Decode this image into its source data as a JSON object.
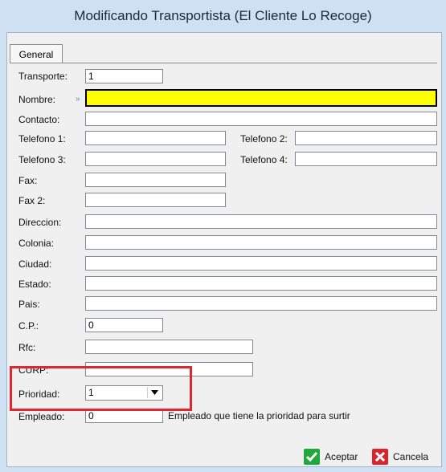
{
  "window": {
    "title": "Modificando Transportista  (El Cliente Lo Recoge)"
  },
  "tabs": {
    "general": "General"
  },
  "fields": {
    "transporte": {
      "label": "Transporte:",
      "value": "1"
    },
    "nombre": {
      "label": "Nombre:",
      "value": "",
      "marker": "»"
    },
    "contacto": {
      "label": "Contacto:",
      "value": ""
    },
    "telefono1": {
      "label": "Telefono 1:",
      "value": ""
    },
    "telefono2": {
      "label": "Telefono 2:",
      "value": ""
    },
    "telefono3": {
      "label": "Telefono 3:",
      "value": ""
    },
    "telefono4": {
      "label": "Telefono 4:",
      "value": ""
    },
    "fax": {
      "label": "Fax:",
      "value": ""
    },
    "fax2": {
      "label": "Fax 2:",
      "value": ""
    },
    "direccion": {
      "label": "Direccion:",
      "value": ""
    },
    "colonia": {
      "label": "Colonia:",
      "value": ""
    },
    "ciudad": {
      "label": "Ciudad:",
      "value": ""
    },
    "estado": {
      "label": "Estado:",
      "value": ""
    },
    "pais": {
      "label": "Pais:",
      "value": ""
    },
    "cp": {
      "label": "C.P.:",
      "value": "0"
    },
    "rfc": {
      "label": "Rfc:",
      "value": ""
    },
    "curp": {
      "label": "CURP:",
      "value": ""
    },
    "prioridad": {
      "label": "Prioridad:",
      "value": "1"
    },
    "empleado": {
      "label": "Empleado:",
      "value": "0",
      "hint": "Empleado que tiene la prioridad para surtir"
    }
  },
  "buttons": {
    "aceptar": "Aceptar",
    "cancelar": "Cancela"
  },
  "colors": {
    "highlight": "#e0262e",
    "accept": "#1fa83c",
    "cancel": "#d9262e",
    "required": "#ffff00"
  }
}
